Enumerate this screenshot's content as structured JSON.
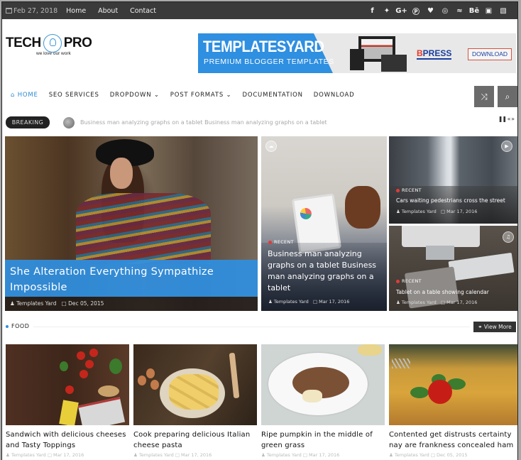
{
  "topbar": {
    "date": "Feb 27, 2018",
    "nav": [
      "Home",
      "About",
      "Contact"
    ],
    "social_icons": [
      {
        "name": "facebook-icon",
        "glyph": "f"
      },
      {
        "name": "twitter-icon",
        "glyph": "✦"
      },
      {
        "name": "google-plus-icon",
        "glyph": "G+"
      },
      {
        "name": "pinterest-icon",
        "glyph": "Ⓟ"
      },
      {
        "name": "heart-icon",
        "glyph": "♥"
      },
      {
        "name": "dribbble-icon",
        "glyph": "◎"
      },
      {
        "name": "rss-icon",
        "glyph": "≈"
      },
      {
        "name": "behance-icon",
        "glyph": "Bē"
      },
      {
        "name": "instagram-icon",
        "glyph": "▣"
      },
      {
        "name": "delicious-icon",
        "glyph": "▧"
      }
    ]
  },
  "header": {
    "logo_left": "TECH",
    "logo_right": "PRO",
    "tagline": "we love our work",
    "banner": {
      "title": "TEMPLATESYARD",
      "subtitle": "PREMIUM BLOGGER TEMPLATES",
      "press_b": "B",
      "press_rest": "PRESS",
      "download": "DOWNLOAD"
    }
  },
  "mainnav": {
    "items": [
      {
        "label": "⌂ HOME",
        "active": true
      },
      {
        "label": "SEO SERVICES"
      },
      {
        "label": "DROPDOWN ⌄"
      },
      {
        "label": "POST FORMATS ⌄"
      },
      {
        "label": "DOCUMENTATION"
      },
      {
        "label": "DOWNLOAD"
      }
    ],
    "shuffle_icon": "⤨",
    "search_icon": "⌕"
  },
  "breaking": {
    "label": "BREAKING",
    "text": "Business man analyzing graphs on a tablet Business man analyzing graphs on a tablet",
    "controls": "❚❚ « »"
  },
  "featured": {
    "big": {
      "title": "She Alteration Everything Sympathize Impossible",
      "author": "♟ Templates Yard",
      "date": "□ Dec 05, 2015"
    },
    "mid": {
      "label": "RECENT",
      "title": "Business man analyzing graphs on a tablet Business man analyzing graphs on a tablet",
      "author": "♟ Templates Yard",
      "date": "□ Mar 17, 2016",
      "format_icon": "☁"
    },
    "small": [
      {
        "label": "RECENT",
        "title": "Cars waiting pedestrians cross the street",
        "author": "♟ Templates Yard",
        "date": "□ Mar 17, 2016",
        "format_icon": "▶"
      },
      {
        "label": "RECENT",
        "title": "Tablet on a table showing calendar",
        "author": "♟ Templates Yard",
        "date": "□ Mar 17, 2016",
        "format_icon": "♫"
      }
    ]
  },
  "food": {
    "heading": "FOOD",
    "view_more": "⚭ View More",
    "posts": [
      {
        "title": "Sandwich with delicious cheeses and Tasty Toppings",
        "meta": "♟ Templates Yard  □ Mar 17, 2016"
      },
      {
        "title": "Cook preparing delicious Italian cheese pasta",
        "meta": "♟ Templates Yard  □ Mar 17, 2016"
      },
      {
        "title": "Ripe pumpkin in the middle of green grass",
        "meta": "♟ Templates Yard  □ Mar 17, 2016"
      },
      {
        "title": "Contented get distrusts certainty nay are frankness concealed ham",
        "meta": "♟ Templates Yard  □ Dec 05, 2015"
      }
    ]
  },
  "colors": {
    "accent": "#2f8fe0",
    "topbar_bg": "#3a3a3a",
    "recent_dot": "#e23b3b"
  }
}
